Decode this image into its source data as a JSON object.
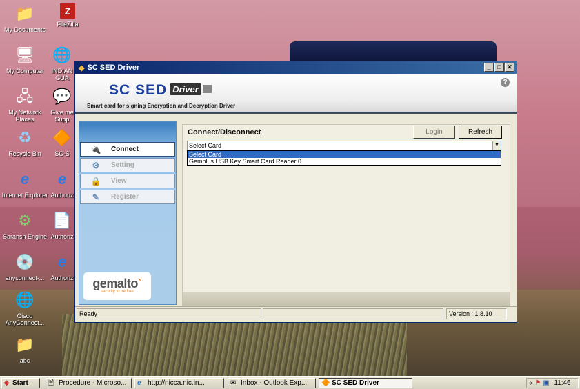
{
  "desktop": {
    "icons": [
      {
        "label": "My Documents",
        "glyph": "📁"
      },
      {
        "label": "FileZilla",
        "glyph": "Z"
      },
      {
        "label": "My Computer",
        "glyph": "🖥"
      },
      {
        "label": "INDIAN GUA",
        "glyph": "🌐"
      },
      {
        "label": "My Network Places",
        "glyph": "🖧"
      },
      {
        "label": "Give me Supp",
        "glyph": "💬"
      },
      {
        "label": "Recycle Bin",
        "glyph": "♻"
      },
      {
        "label": "SC-S",
        "glyph": "🔶"
      },
      {
        "label": "Internet Explorer",
        "glyph": "e"
      },
      {
        "label": "Authoriz",
        "glyph": "e"
      },
      {
        "label": "Saransh Engine",
        "glyph": "⚙"
      },
      {
        "label": "Authoriz",
        "glyph": "📄"
      },
      {
        "label": "anyconnect-...",
        "glyph": "💿"
      },
      {
        "label": "Authoriz",
        "glyph": "e"
      },
      {
        "label": "Cisco AnyConnect...",
        "glyph": "🌐"
      },
      {
        "label": "abc",
        "glyph": "📁"
      }
    ]
  },
  "window": {
    "title": "SC SED Driver",
    "controls": {
      "minimize": "_",
      "maximize": "□",
      "close": "✕"
    },
    "banner": {
      "logo_main": "SC SED",
      "logo_badge": "Driver",
      "subtitle": "Smart card for signing Encryption and Decryption Driver",
      "help": "?"
    },
    "nav": [
      {
        "label": "Connect",
        "icon": "connect-icon",
        "glyph": "🔌",
        "active": true
      },
      {
        "label": "Setting",
        "icon": "setting-icon",
        "glyph": "⚙",
        "active": false
      },
      {
        "label": "View",
        "icon": "view-icon",
        "glyph": "🔒",
        "active": false
      },
      {
        "label": "Register",
        "icon": "register-icon",
        "glyph": "✎",
        "active": false
      }
    ],
    "brand": {
      "name": "gemalto",
      "tagline": "security to be free"
    },
    "panel": {
      "title": "Connect/Disconnect",
      "login_label": "Login",
      "refresh_label": "Refresh",
      "select_value": "Select Card",
      "options": [
        "Select Card",
        "Gemplus USB Key Smart Card Reader 0"
      ]
    },
    "status": {
      "text": "Ready",
      "version": "Version : 1.8.10"
    }
  },
  "taskbar": {
    "start_label": "Start",
    "tasks": [
      {
        "label": "Procedure - Microso...",
        "glyph": "🗎"
      },
      {
        "label": "http://nicca.nic.in...",
        "glyph": "e"
      },
      {
        "label": "Inbox - Outlook Exp...",
        "glyph": "✉"
      },
      {
        "label": "SC SED Driver",
        "glyph": "🔶"
      }
    ],
    "tray_chevron": "«",
    "clock": "11:46"
  }
}
